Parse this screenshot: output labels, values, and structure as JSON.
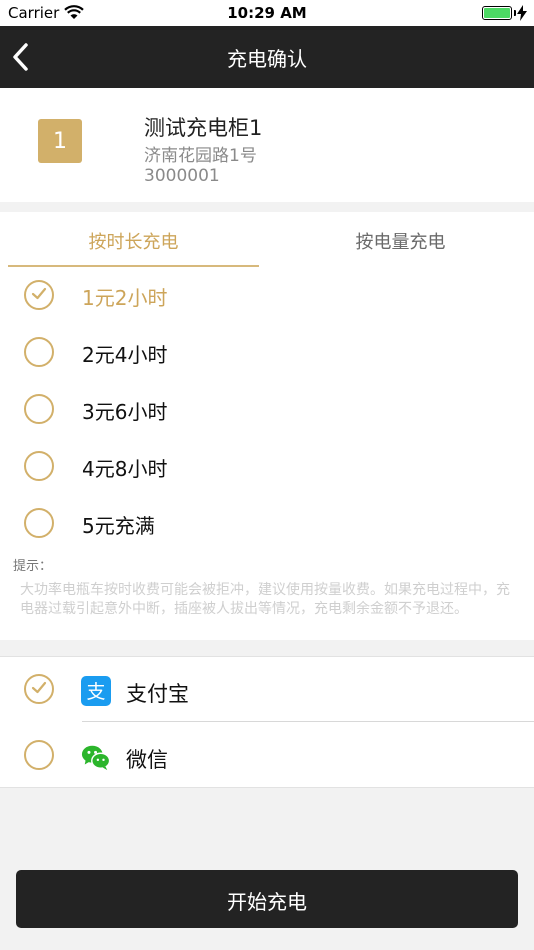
{
  "status_bar": {
    "carrier": "Carrier",
    "time": "10:29 AM"
  },
  "nav": {
    "title": "充电确认"
  },
  "cabinet": {
    "badge": "1",
    "name": "测试充电柜1",
    "address": "济南花园路1号",
    "id": "3000001"
  },
  "tabs": [
    {
      "label": "按时长充电",
      "active": true
    },
    {
      "label": "按电量充电",
      "active": false
    }
  ],
  "options": [
    {
      "label": "1元2小时",
      "selected": true
    },
    {
      "label": "2元4小时",
      "selected": false
    },
    {
      "label": "3元6小时",
      "selected": false
    },
    {
      "label": "4元8小时",
      "selected": false
    },
    {
      "label": "5元充满",
      "selected": false
    }
  ],
  "tips": {
    "title": "提示：",
    "text": "大功率电瓶车按时收费可能会被拒冲，建议使用按量收费。如果充电过程中，充电器过载引起意外中断，插座被人拔出等情况，充电剩余金额不予退还。"
  },
  "payments": [
    {
      "label": "支付宝",
      "icon": "alipay-icon",
      "selected": true
    },
    {
      "label": "微信",
      "icon": "wechat-icon",
      "selected": false
    }
  ],
  "start_button": {
    "label": "开始充电"
  },
  "colors": {
    "accent": "#d2b06a",
    "dark": "#232323",
    "background": "#f2f2f2"
  }
}
